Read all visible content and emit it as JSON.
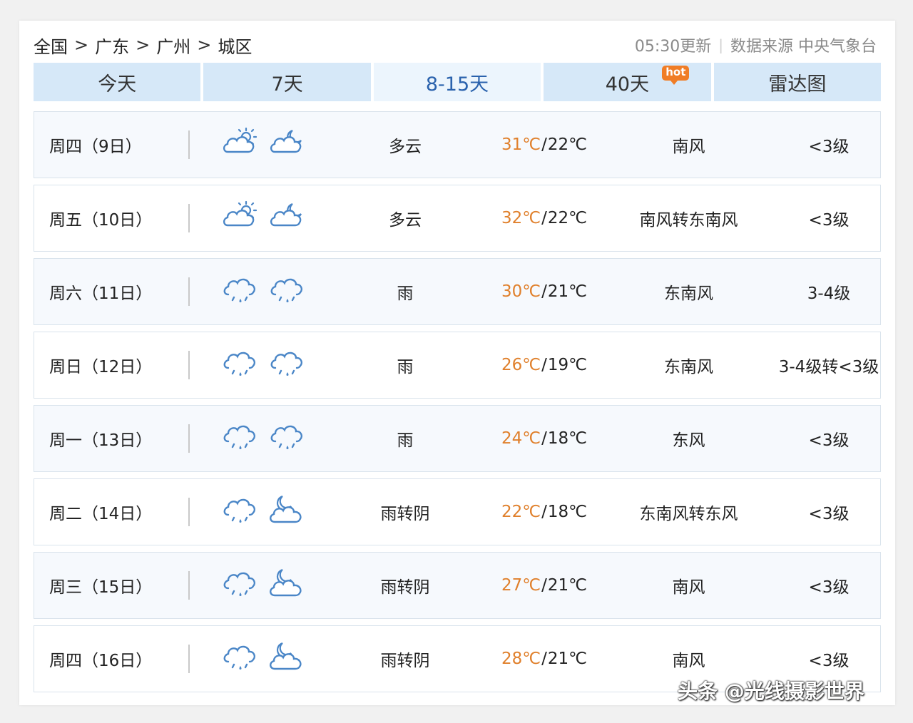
{
  "breadcrumb": [
    "全国",
    "广东",
    "广州",
    "城区"
  ],
  "breadcrumb_sep": ">",
  "update_time": "05:30更新",
  "source_divider": "|",
  "source_label": "数据来源 中央气象台",
  "tabs": [
    {
      "label": "今天"
    },
    {
      "label": "7天"
    },
    {
      "label": "8-15天"
    },
    {
      "label": "40天",
      "badge": "hot"
    },
    {
      "label": "雷达图"
    }
  ],
  "active_tab": 2,
  "colors": {
    "high_temp": "#e0802c",
    "active_tab_text": "#2a62ad",
    "tab_bg": "#d6e8f8",
    "icon": "#4a86c7"
  },
  "forecast": [
    {
      "date": "周四（9日）",
      "day_icon": "partly-cloudy-day-icon",
      "night_icon": "partly-cloudy-night-icon",
      "desc": "多云",
      "high": "31℃",
      "low": "22℃",
      "wind": "南风",
      "level": "<3级"
    },
    {
      "date": "周五（10日）",
      "day_icon": "partly-cloudy-day-icon",
      "night_icon": "partly-cloudy-night-icon",
      "desc": "多云",
      "high": "32℃",
      "low": "22℃",
      "wind": "南风转东南风",
      "level": "<3级"
    },
    {
      "date": "周六（11日）",
      "day_icon": "rain-icon",
      "night_icon": "rain-icon",
      "desc": "雨",
      "high": "30℃",
      "low": "21℃",
      "wind": "东南风",
      "level": "3-4级"
    },
    {
      "date": "周日（12日）",
      "day_icon": "rain-icon",
      "night_icon": "rain-icon",
      "desc": "雨",
      "high": "26℃",
      "low": "19℃",
      "wind": "东南风",
      "level": "3-4级转<3级"
    },
    {
      "date": "周一（13日）",
      "day_icon": "rain-icon",
      "night_icon": "rain-icon",
      "desc": "雨",
      "high": "24℃",
      "low": "18℃",
      "wind": "东风",
      "level": "<3级"
    },
    {
      "date": "周二（14日）",
      "day_icon": "rain-icon",
      "night_icon": "overcast-night-icon",
      "desc": "雨转阴",
      "high": "22℃",
      "low": "18℃",
      "wind": "东南风转东风",
      "level": "<3级"
    },
    {
      "date": "周三（15日）",
      "day_icon": "rain-icon",
      "night_icon": "overcast-night-icon",
      "desc": "雨转阴",
      "high": "27℃",
      "low": "21℃",
      "wind": "南风",
      "level": "<3级"
    },
    {
      "date": "周四（16日）",
      "day_icon": "rain-icon",
      "night_icon": "overcast-night-icon",
      "desc": "雨转阴",
      "high": "28℃",
      "low": "21℃",
      "wind": "南风",
      "level": "<3级"
    }
  ],
  "watermark": "头条 @光线摄影世界"
}
